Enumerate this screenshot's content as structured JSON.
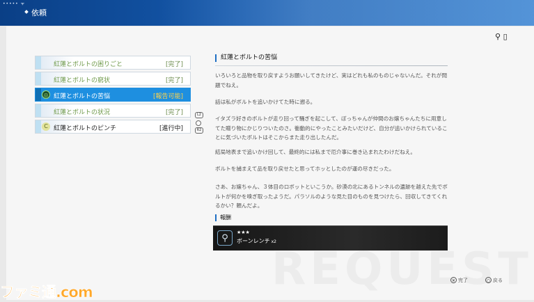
{
  "header": {
    "status_text": "••••• ᯤ",
    "title": "依頼"
  },
  "top_right": {
    "icon": "wrench-icon",
    "battery_icon": "battery-icon"
  },
  "quests": [
    {
      "label": "紅蓮とボルトの困りごと",
      "status": "[完了]",
      "state": "done"
    },
    {
      "label": "紅蓮とボルトの窮状",
      "status": "[完了]",
      "state": "done"
    },
    {
      "label": "紅蓮とボルトの苦悩",
      "status": "[報告可能]",
      "state": "active",
      "icon_glyph": "◎"
    },
    {
      "label": "紅蓮とボルトの状況",
      "status": "[完了]",
      "state": "done"
    },
    {
      "label": "紅蓮とボルトのピンチ",
      "status": "[進行中]",
      "state": "going",
      "icon_glyph": "C"
    }
  ],
  "scroll": {
    "up": "L2",
    "down": "R2"
  },
  "detail": {
    "title": "紅蓮とボルトの苦悩",
    "paragraphs": [
      "いろいろと品物を取り戻すようお願いしてきたけど、実はどれも私のものじゃないんだ。それが問題でねえ。",
      "話は私がボルトを追いかけてた時に遡る。",
      "イタズラ好きのボルトが走り回って騒ぎを起こして、ぼっちゃんが仲間のお嬢ちゃんたちに用意してた贈り物にかじりついたのさ。衝動的にやったことみたいだけど、自分が追いかけられていることに気づいたボルトはそこからまた走り出したんだ。",
      "結局地表まで追いかけ回して、最終的には私まで厄介事に巻き込まれたわけだねえ。",
      "ボルトを捕まえて品を取り戻せたと思ってホッとしたのが運の尽きだった。",
      "さあ、お嬢ちゃん、３体目のロボットといこうか。砂漠の北にあるトンネルの遺跡を越えた先でボルトが何かを嗅ぎ取ったようだ。パラソルのような見た目のものを見つけたら、回収してきてくれるかい？頼んだよ。"
    ]
  },
  "reward": {
    "section_label": "報酬",
    "stars": "★★★",
    "name": "ボーンレンチ",
    "qty": "x2",
    "icon": "wrench-icon"
  },
  "footer": {
    "left_button": "✕",
    "left_label": "完了",
    "right_button": "○",
    "right_label": "戻る"
  },
  "watermark": "REQUEST",
  "logo_text": "ファミ通.com",
  "colors": {
    "accent": "#1e8fe0",
    "header": "#1559ad",
    "done": "#6f9a4a",
    "reportable": "#ffd34a"
  }
}
